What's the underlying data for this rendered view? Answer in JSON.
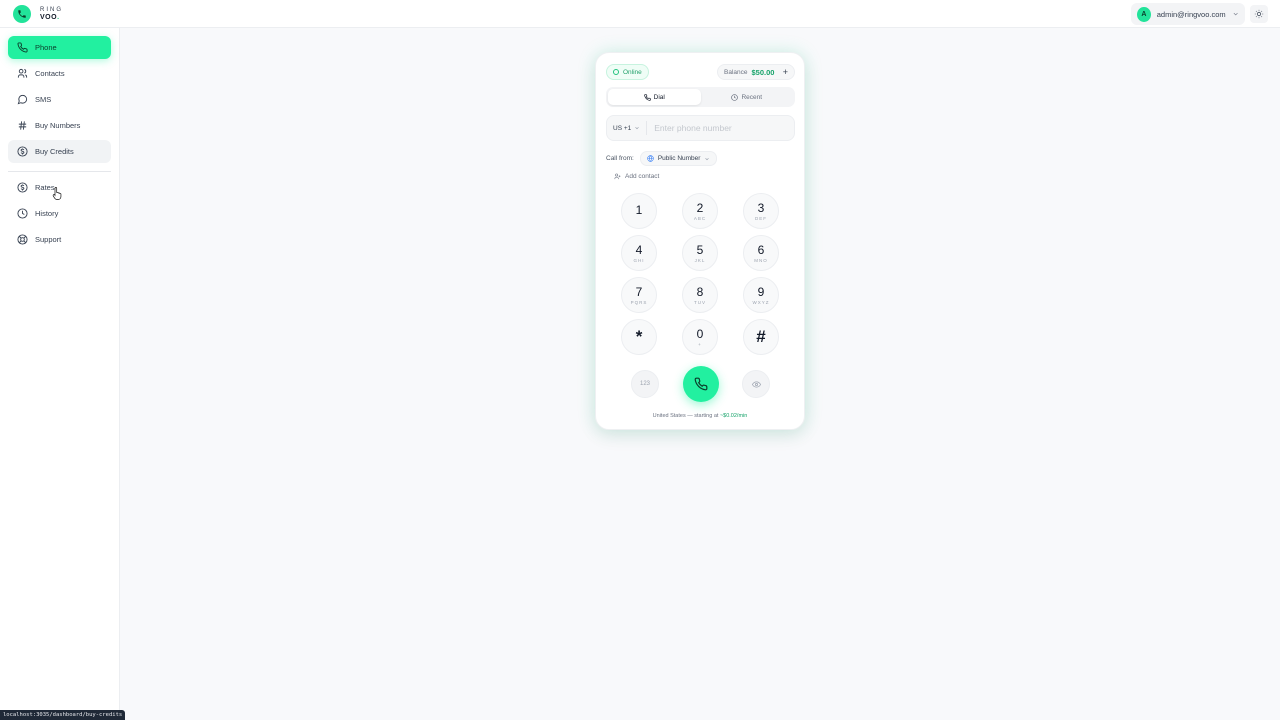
{
  "brand": {
    "line1": "RING",
    "line2_a": "VOO",
    "line2_b": "."
  },
  "user": {
    "avatar": "A",
    "email": "admin@ringvoo.com"
  },
  "icons": {
    "theme": "sun-icon",
    "phone": "phone-icon",
    "contacts": "users-icon",
    "sms": "chat-bubble-icon",
    "numbers": "hash-icon",
    "credits": "dollar-circle-icon",
    "rates": "dollar-circle-icon",
    "history": "clock-icon",
    "support": "lifebuoy-icon"
  },
  "colors": {
    "accent": "#22f0a0",
    "accent_dark": "#16a36a"
  },
  "sidebar": {
    "items": [
      {
        "label": "Phone",
        "active": true
      },
      {
        "label": "Contacts"
      },
      {
        "label": "SMS"
      },
      {
        "label": "Buy Numbers"
      },
      {
        "label": "Buy Credits",
        "hover": true
      },
      {
        "label": "Rates"
      },
      {
        "label": "History"
      },
      {
        "label": "Support"
      }
    ]
  },
  "dialer": {
    "status": "Online",
    "balance_label": "Balance",
    "balance_value": "$50.00",
    "balance_add": "+",
    "tabs": [
      {
        "label": "Dial",
        "active": true
      },
      {
        "label": "Recent"
      }
    ],
    "country_code": "US +1",
    "phone_placeholder": "Enter phone number",
    "call_from_label": "Call from:",
    "call_from_value": "Public Number",
    "add_contact": "Add contact",
    "keys": [
      {
        "d": "1",
        "s": ""
      },
      {
        "d": "2",
        "s": "ABC"
      },
      {
        "d": "3",
        "s": "DEF"
      },
      {
        "d": "4",
        "s": "GHI"
      },
      {
        "d": "5",
        "s": "JKL"
      },
      {
        "d": "6",
        "s": "MNO"
      },
      {
        "d": "7",
        "s": "PQRS"
      },
      {
        "d": "8",
        "s": "TUV"
      },
      {
        "d": "9",
        "s": "WXYZ"
      },
      {
        "d": "*",
        "s": ""
      },
      {
        "d": "0",
        "s": "+"
      },
      {
        "d": "#",
        "s": ""
      }
    ],
    "keypad_toggle": "123",
    "rate_country": "United States",
    "rate_sep": "—",
    "rate_text": "starting at",
    "rate_value": "~$0.02/min"
  },
  "status_bar_url": "localhost:3035/dashboard/buy-credits"
}
